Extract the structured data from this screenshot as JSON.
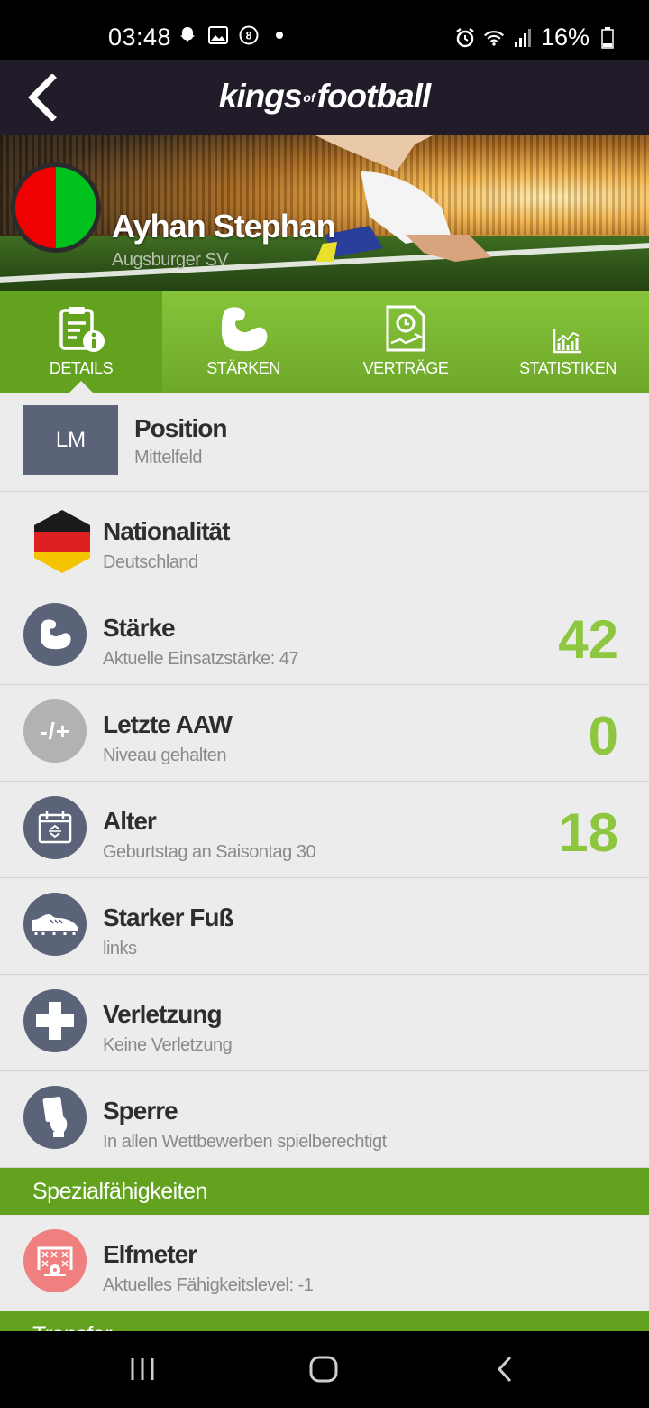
{
  "status_bar": {
    "time": "03:48",
    "battery_text": "16%",
    "left_icons": [
      "snapchat-icon",
      "gallery-icon",
      "app-badge-icon",
      "dot-icon"
    ],
    "right_icons": [
      "alarm-icon",
      "wifi-icon",
      "signal-icon",
      "battery-icon"
    ]
  },
  "app_bar": {
    "brand_part1": "kings",
    "brand_of": "of",
    "brand_part2": "football"
  },
  "player": {
    "name": "Ayhan Stephan",
    "club": "Augsburger SV",
    "club_colors": [
      "#f00000",
      "#00c21e"
    ]
  },
  "tabs": [
    {
      "label": "DETAILS",
      "icon": "details-icon",
      "active": true
    },
    {
      "label": "STÄRKEN",
      "icon": "muscle-icon",
      "active": false
    },
    {
      "label": "VERTRÄGE",
      "icon": "contract-icon",
      "active": false
    },
    {
      "label": "STATISTIKEN",
      "icon": "statistics-icon",
      "active": false
    }
  ],
  "details": {
    "position": {
      "badge": "LM",
      "title": "Position",
      "sub": "Mittelfeld"
    },
    "nationality": {
      "title": "Nationalität",
      "sub": "Deutschland",
      "flag_colors": [
        "#1a1a1a",
        "#dd1f1f",
        "#f5c400"
      ]
    },
    "strength": {
      "title": "Stärke",
      "sub": "Aktuelle Einsatzstärke: 47",
      "value": "42",
      "icon": "muscle-icon"
    },
    "last_aaw": {
      "title": "Letzte AAW",
      "sub": "Niveau gehalten",
      "value": "0",
      "icon_text": "-/+"
    },
    "age": {
      "title": "Alter",
      "sub": "Geburtstag an Saisontag 30",
      "value": "18",
      "icon": "calendar-icon"
    },
    "foot": {
      "title": "Starker Fuß",
      "sub": "links",
      "icon": "boot-icon"
    },
    "injury": {
      "title": "Verletzung",
      "sub": "Keine Verletzung",
      "icon": "cross-icon"
    },
    "suspension": {
      "title": "Sperre",
      "sub": "In allen Wettbewerben spielberechtigt",
      "icon": "card-icon"
    }
  },
  "special_section": {
    "header": "Spezialfähigkeiten",
    "items": [
      {
        "title": "Elfmeter",
        "sub": "Aktuelles Fähigkeitslevel: -1",
        "icon": "penalty-icon"
      }
    ]
  },
  "transfer_section": {
    "header": "Transfer"
  },
  "colors": {
    "accent_green": "#8dc63f",
    "tab_green": "#6ea82a",
    "section_green": "#62a21f",
    "icon_slate": "#5b6378",
    "app_bar": "#221c2a"
  }
}
